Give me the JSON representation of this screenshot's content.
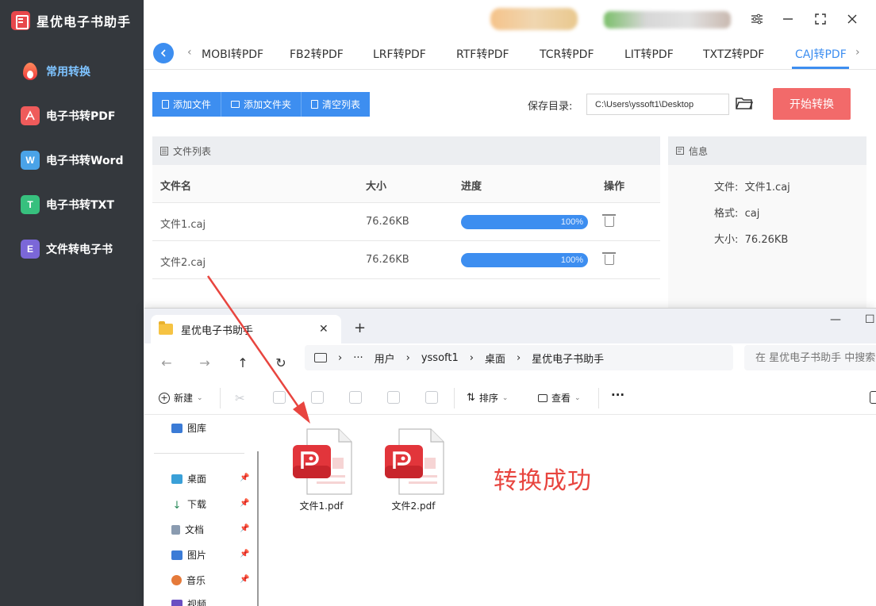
{
  "app": {
    "title": "星优电子书助手"
  },
  "sidebar": {
    "items": [
      {
        "label": "常用转换"
      },
      {
        "label": "电子书转PDF",
        "icon_text": "⏵"
      },
      {
        "label": "电子书转Word",
        "icon_text": "W"
      },
      {
        "label": "电子书转TXT",
        "icon_text": "T"
      },
      {
        "label": "文件转电子书",
        "icon_text": "E"
      }
    ]
  },
  "tabs": [
    "MOBI转PDF",
    "FB2转PDF",
    "LRF转PDF",
    "RTF转PDF",
    "TCR转PDF",
    "LIT转PDF",
    "TXTZ转PDF",
    "CAJ转PDF"
  ],
  "toolbar": {
    "add_file": "添加文件",
    "add_folder": "添加文件夹",
    "clear_list": "清空列表",
    "save_dir_label": "保存目录:",
    "save_dir_value": "C:\\Users\\yssoft1\\Desktop",
    "start": "开始转换"
  },
  "file_list": {
    "title": "文件列表",
    "columns": [
      "文件名",
      "大小",
      "进度",
      "操作"
    ],
    "rows": [
      {
        "name": "文件1.caj",
        "size": "76.26KB",
        "progress_label": "100%",
        "progress": 1.0
      },
      {
        "name": "文件2.caj",
        "size": "76.26KB",
        "progress_label": "100%",
        "progress": 1.0
      }
    ]
  },
  "info": {
    "title": "信息",
    "file_label": "文件:",
    "file_value": "文件1.caj",
    "format_label": "格式:",
    "format_value": "caj",
    "size_label": "大小:",
    "size_value": "76.26KB"
  },
  "explorer": {
    "tab_title": "星优电子书助手",
    "breadcrumb": [
      "用户",
      "yssoft1",
      "桌面",
      "星优电子书助手"
    ],
    "search_placeholder": "在 星优电子书助手 中搜索",
    "commands": {
      "new": "新建",
      "sort": "排序",
      "view": "查看"
    },
    "sidebar": [
      {
        "label": "图库"
      },
      {
        "label": "桌面"
      },
      {
        "label": "下载"
      },
      {
        "label": "文档"
      },
      {
        "label": "图片"
      },
      {
        "label": "音乐"
      },
      {
        "label": "视频"
      }
    ],
    "files": [
      "文件1.pdf",
      "文件2.pdf"
    ]
  },
  "annotation": "转换成功",
  "colors": {
    "accent": "#3d8ef0",
    "start_button": "#f26a6a",
    "sidebar_bg": "#34383d",
    "annotation": "#e8453f"
  }
}
